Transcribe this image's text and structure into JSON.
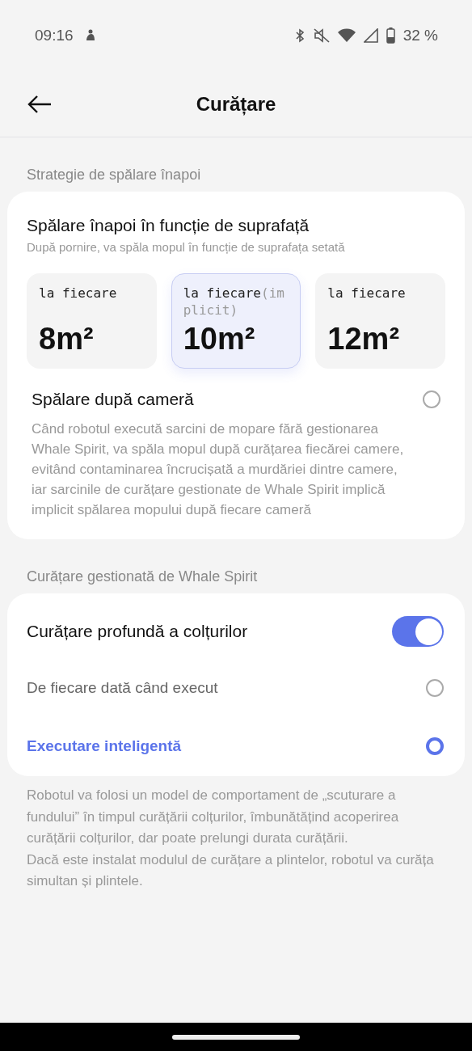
{
  "status_bar": {
    "time": "09:16",
    "battery": "32 %"
  },
  "header": {
    "title": "Curățare"
  },
  "sections": [
    {
      "label": "Strategie de spălare înapoi",
      "card": {
        "title": "Spălare înapoi în funcție de suprafață",
        "subtitle": "După pornire, va spăla mopul în funcție de suprafața setată",
        "tiles": [
          {
            "label": "la fiecare",
            "value": "8m²",
            "selected": false
          },
          {
            "label": "la fiecare",
            "note": "(implicit)",
            "value": "10m²",
            "selected": true
          },
          {
            "label": "la fiecare",
            "value": "12m²",
            "selected": false
          }
        ],
        "option": {
          "label": "Spălare după cameră",
          "selected": false
        },
        "description": "Când robotul execută sarcini de mopare fără gestionarea Whale Spirit, va spăla mopul după curățarea fiecărei camere, evitând contaminarea încrucișată a murdăriei dintre camere, iar sarcinile de curățare gestionate de Whale Spirit implică implicit spălarea mopului după fiecare cameră"
      }
    },
    {
      "label": "Curățare gestionată de Whale Spirit",
      "card": {
        "toggle": {
          "label": "Curățare profundă a colțurilor",
          "on": true
        },
        "choices": [
          {
            "label": "De fiecare dată când execut",
            "selected": false
          },
          {
            "label": "Executare inteligentă",
            "selected": true
          }
        ]
      }
    }
  ],
  "footer": [
    "Robotul va folosi un model de comportament de „scuturare a fundului” în timpul curățării colțurilor, îmbunătățind acoperirea curățării colțurilor, dar poate prelungi durata curățării.",
    "Dacă este instalat modulul de curățare a plintelor, robotul va curăța simultan și plintele."
  ]
}
